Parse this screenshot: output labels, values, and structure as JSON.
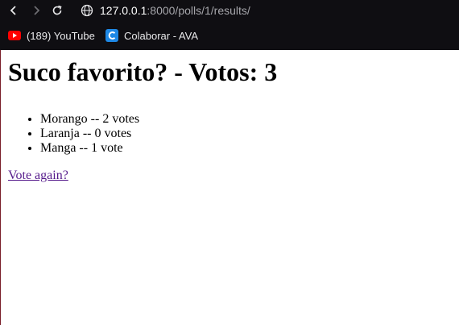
{
  "browser": {
    "url_host": "127.0.0.1",
    "url_rest": ":8000/polls/1/results/",
    "icons": [
      "back-icon",
      "forward-icon",
      "reload-icon",
      "site-info-icon"
    ],
    "bookmarks": [
      {
        "label": "(189) YouTube",
        "icon": "youtube-icon",
        "color": "#ff0000"
      },
      {
        "label": "Colaborar - AVA",
        "icon": "colaborar-icon",
        "color": "#1e88e5"
      }
    ]
  },
  "page": {
    "title": "Suco favorito? - Votos: 3",
    "results": [
      {
        "text": "Morango -- 2 votes"
      },
      {
        "text": "Laranja -- 0 votes"
      },
      {
        "text": "Manga -- 1 vote"
      }
    ],
    "vote_again": "Vote again?",
    "link_color": "#551a8b"
  }
}
